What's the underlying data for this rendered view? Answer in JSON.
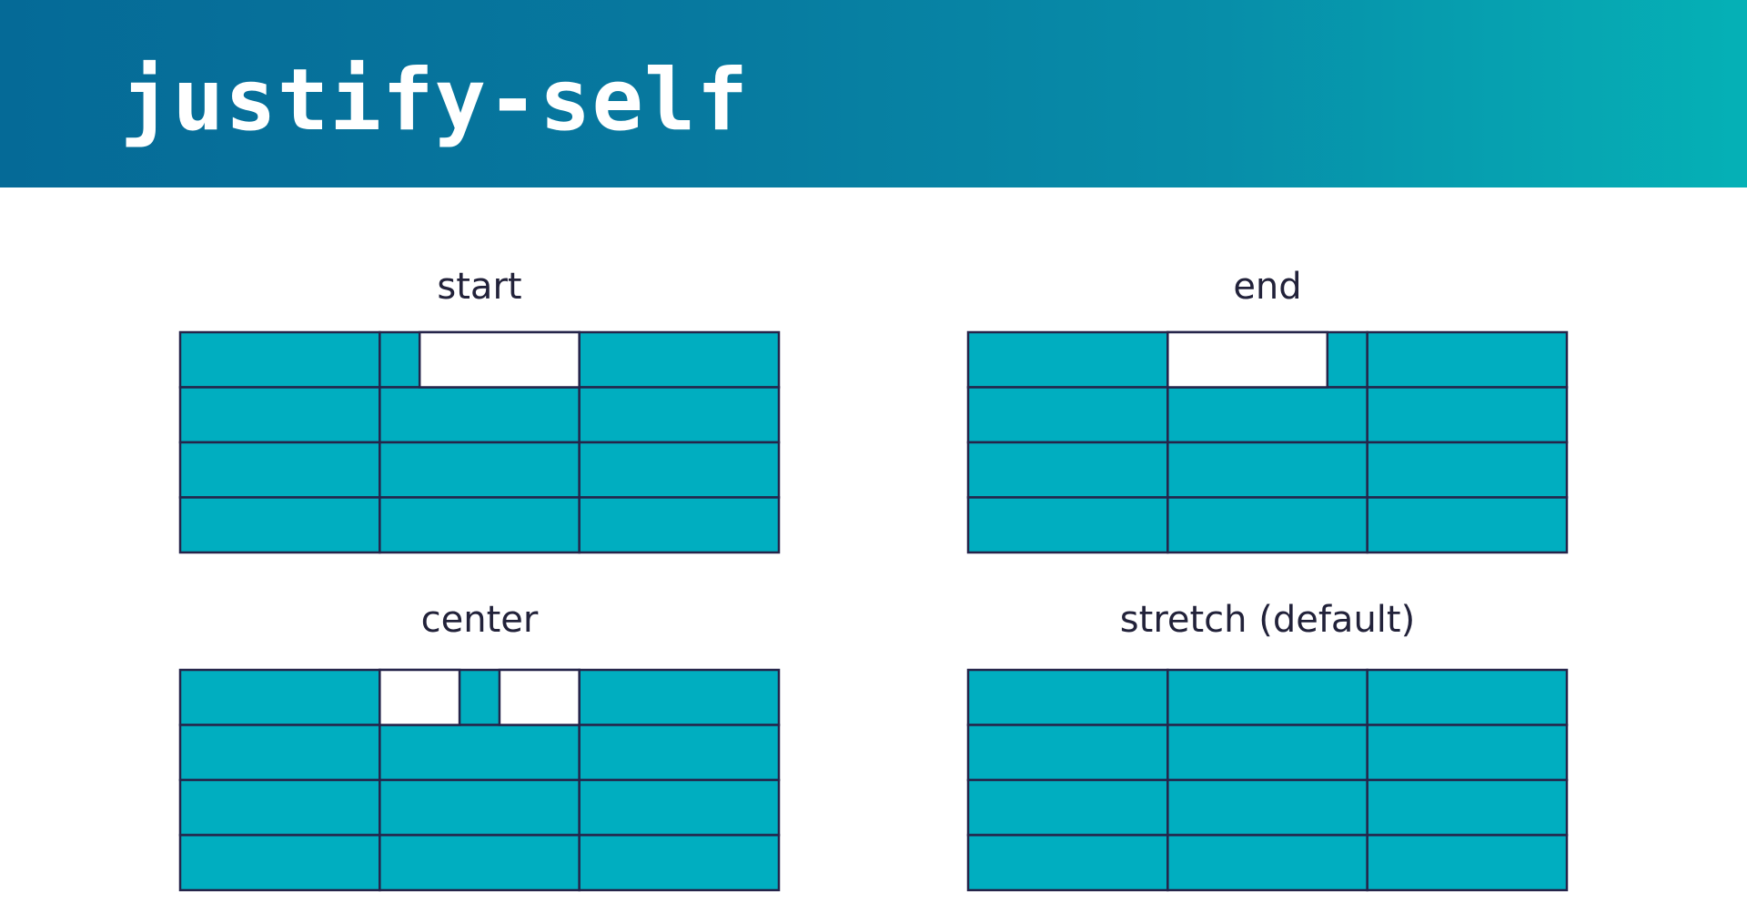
{
  "slide": {
    "title": "justify-self"
  },
  "colors": {
    "header_gradient_start": "#056a97",
    "header_gradient_end": "#05b1b6",
    "cell_fill": "#00aec0",
    "grid_line": "#25244a",
    "item_fill": "#ffffff",
    "label_text": "#22223a"
  },
  "panels": [
    {
      "label": "start",
      "alignment": "start",
      "item_width_fraction": 0.8
    },
    {
      "label": "end",
      "alignment": "end",
      "item_width_fraction": 0.8
    },
    {
      "label": "center",
      "alignment": "center",
      "item_width_fraction": 0.4
    },
    {
      "label": "stretch (default)",
      "alignment": "stretch",
      "item_width_fraction": 1.0
    }
  ],
  "grid": {
    "columns": 3,
    "rows": 4,
    "highlighted_cell": {
      "row": 1,
      "column": 2
    }
  }
}
